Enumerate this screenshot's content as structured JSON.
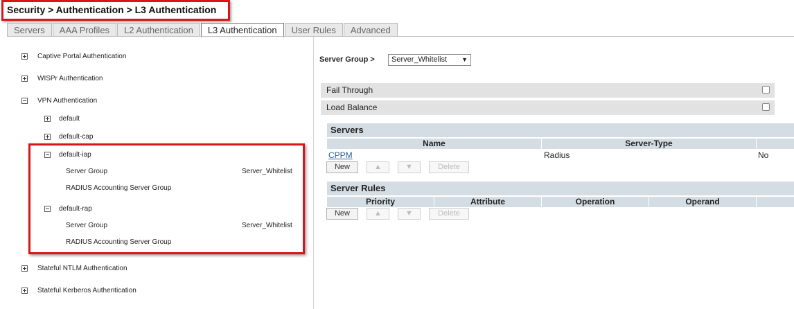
{
  "breadcrumb": "Security > Authentication > L3 Authentication",
  "tabs": [
    "Servers",
    "AAA Profiles",
    "L2 Authentication",
    "L3 Authentication",
    "User Rules",
    "Advanced"
  ],
  "active_tab": "L3 Authentication",
  "tree": {
    "captive_portal": "Captive Portal Authentication",
    "wispr": "WISPr Authentication",
    "vpn": "VPN Authentication",
    "vpn_default": "default",
    "vpn_default_cap": "default-cap",
    "vpn_default_iap": "default-iap",
    "iap_server_group_label": "Server Group",
    "iap_server_group_value": "Server_Whitelist",
    "iap_radius_label": "RADIUS Accounting Server Group",
    "vpn_default_rap": "default-rap",
    "rap_server_group_label": "Server Group",
    "rap_server_group_value": "Server_Whitelist",
    "rap_radius_label": "RADIUS Accounting Server Group",
    "stateful_ntlm": "Stateful NTLM Authentication",
    "stateful_kerberos": "Stateful Kerberos Authentication"
  },
  "server_group": {
    "label": "Server Group >",
    "selected": "Server_Whitelist",
    "arrow": "▼"
  },
  "options": {
    "fail_through": "Fail Through",
    "load_balance": "Load Balance"
  },
  "servers": {
    "title": "Servers",
    "columns": [
      "Name",
      "Server-Type"
    ],
    "row": {
      "name": "CPPM",
      "type": "Radius",
      "extra": "No"
    }
  },
  "server_rules": {
    "title": "Server Rules",
    "columns": [
      "Priority",
      "Attribute",
      "Operation",
      "Operand"
    ]
  },
  "buttons": {
    "new": "New",
    "up": "▲",
    "down": "▼",
    "delete": "Delete"
  }
}
